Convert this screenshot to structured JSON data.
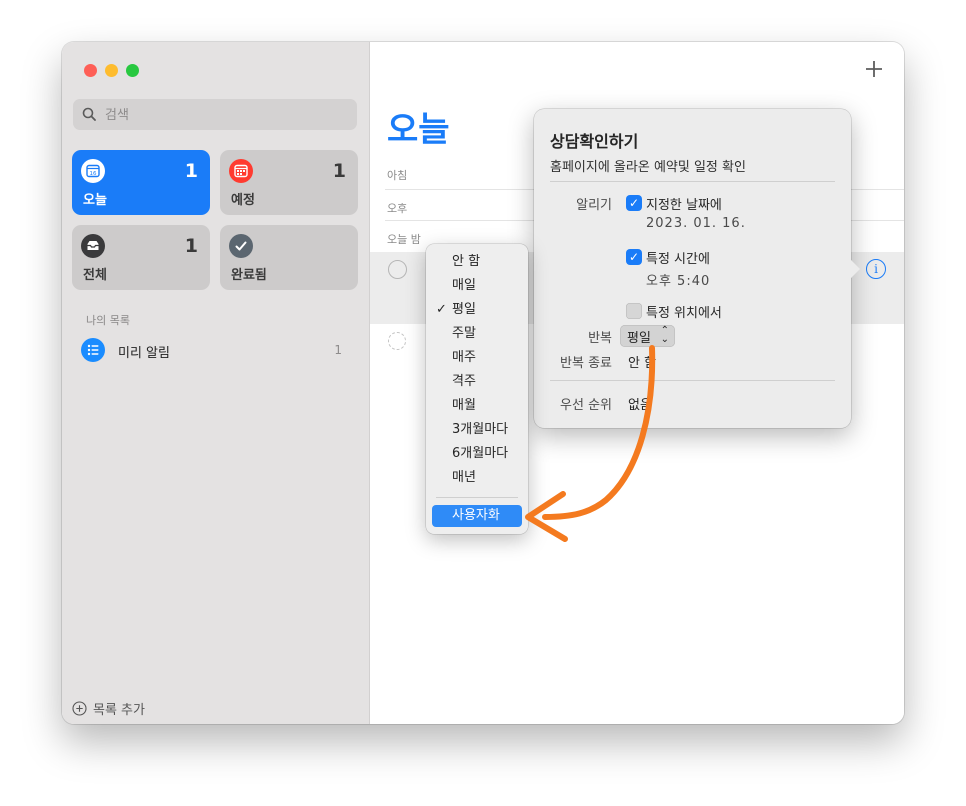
{
  "window": {
    "controls": [
      "close",
      "minimize",
      "zoom"
    ]
  },
  "sidebar": {
    "search_placeholder": "검색",
    "tiles": [
      {
        "label": "오늘",
        "count": "1",
        "icon": "calendar-today-icon",
        "date": "16",
        "selected": true
      },
      {
        "label": "예정",
        "count": "1",
        "icon": "calendar-scheduled-icon",
        "selected": false
      },
      {
        "label": "전체",
        "count": "1",
        "icon": "tray-all-icon",
        "selected": false
      },
      {
        "label": "완료됨",
        "count": "",
        "icon": "checkmark-done-icon",
        "selected": false
      }
    ],
    "section_label": "나의 목록",
    "lists": [
      {
        "label": "미리 알림",
        "count": "1",
        "icon": "list-bullet-icon"
      }
    ],
    "add_list_label": "목록 추가"
  },
  "main": {
    "title": "오늘",
    "sections": [
      "아침",
      "오후",
      "오늘 밤"
    ]
  },
  "detail_popover": {
    "title": "상담확인하기",
    "note": "홈페이지에 올라온 예약및 일정 확인",
    "alert_label": "알리기",
    "on_date": {
      "checked": true,
      "label": "지정한 날짜에",
      "value": "2023. 01. 16."
    },
    "at_time": {
      "checked": true,
      "label": "특정 시간에",
      "value": "오후   5:40"
    },
    "at_location": {
      "checked": false,
      "label": "특정 위치에서"
    },
    "repeat_label": "반복",
    "repeat_value": "평일",
    "end_repeat_label": "반복 종료",
    "end_repeat_value": "안 함",
    "priority_label": "우선 순위",
    "priority_value": "없음"
  },
  "repeat_menu": {
    "items": [
      "안 함",
      "매일",
      "평일",
      "주말",
      "매주",
      "격주",
      "매월",
      "3개월마다",
      "6개월마다",
      "매년"
    ],
    "selected": "평일",
    "custom": "사용자화"
  },
  "colors": {
    "accent": "#1a7cf8",
    "annotation_arrow": "#f47a1f"
  }
}
